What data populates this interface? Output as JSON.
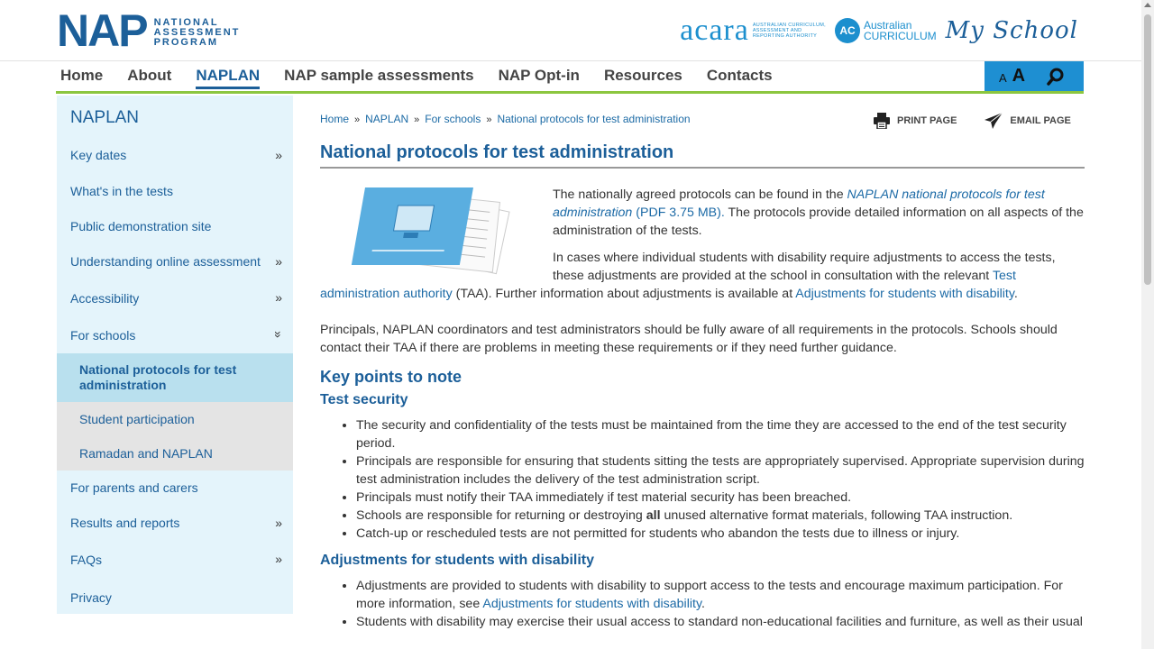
{
  "header": {
    "nap_logo_big": "NAP",
    "nap_logo_lines": [
      "NATIONAL",
      "ASSESSMENT",
      "PROGRAM"
    ],
    "acara_word": "acara",
    "acara_sub": [
      "AUSTRALIAN CURRICULUM,",
      "ASSESSMENT AND",
      "REPORTING AUTHORITY"
    ],
    "ac_badge": "AC",
    "ac_text": [
      "Australian",
      "CURRICULUM"
    ],
    "myschool": "My School"
  },
  "nav": {
    "items": [
      {
        "label": "Home",
        "active": false
      },
      {
        "label": "About",
        "active": false
      },
      {
        "label": "NAPLAN",
        "active": true
      },
      {
        "label": "NAP sample assessments",
        "active": false
      },
      {
        "label": "NAP Opt-in",
        "active": false
      },
      {
        "label": "Resources",
        "active": false
      },
      {
        "label": "Contacts",
        "active": false
      }
    ],
    "font_small": "A",
    "font_large": "A"
  },
  "sidebar": {
    "title": "NAPLAN",
    "items": [
      {
        "label": "Key dates",
        "chevron": "»"
      },
      {
        "label": "What's in the tests",
        "chevron": ""
      },
      {
        "label": "Public demonstration site",
        "chevron": ""
      },
      {
        "label": "Understanding online assessment",
        "chevron": "»"
      },
      {
        "label": "Accessibility",
        "chevron": "»"
      },
      {
        "label": "For schools",
        "chevron": "»"
      }
    ],
    "sub_items": [
      {
        "label": "National protocols for test administration",
        "active": true
      },
      {
        "label": "Student participation",
        "active": false
      },
      {
        "label": "Ramadan and NAPLAN",
        "active": false
      }
    ],
    "items_after": [
      {
        "label": "For parents and carers",
        "chevron": ""
      },
      {
        "label": "Results and reports",
        "chevron": "»"
      },
      {
        "label": "FAQs",
        "chevron": "»"
      },
      {
        "label": "Privacy",
        "chevron": ""
      }
    ]
  },
  "breadcrumb": [
    "Home",
    "NAPLAN",
    "For schools",
    "National protocols for test administration"
  ],
  "actions": {
    "print": "PRINT PAGE",
    "email": "EMAIL PAGE"
  },
  "page_title": "National protocols for test administration",
  "intro": {
    "p1_before": "The nationally agreed protocols can be found in the ",
    "p1_link": "NAPLAN national protocols for test administration",
    "p1_link_meta": " (PDF 3.75 MB).",
    "p1_after": " The protocols provide detailed information on all aspects of the administration of the tests.",
    "p2_before": "In cases where individual students with disability require adjustments to access the tests, these adjustments are provided at the school in consultation with the relevant ",
    "p2_link1": "Test administration authority",
    "p2_mid": " (TAA). Further information about adjustments is available at ",
    "p2_link2": "Adjustments for students with disability",
    "p2_end": ".",
    "p3": "Principals, NAPLAN coordinators and test administrators should be fully aware of all requirements in the protocols. Schools should contact their TAA if there are problems in meeting these requirements or if they need further guidance."
  },
  "key_points_heading": "Key points to note",
  "security": {
    "heading": "Test security",
    "bullets": [
      "The security and confidentiality of the tests must be maintained from the time they are accessed to the end of the test security period.",
      "Principals are responsible for ensuring that students sitting the tests are appropriately supervised. Appropriate supervision during test administration includes the delivery of the test administration script.",
      "Principals must notify their TAA immediately if test material security has been breached."
    ],
    "bullet4_before": "Schools are responsible for returning or destroying ",
    "bullet4_bold": "all",
    "bullet4_after": " unused alternative format materials, following TAA instruction.",
    "bullet5": "Catch-up or rescheduled tests are not permitted for students who abandon the tests due to illness or injury."
  },
  "adjustments": {
    "heading": "Adjustments for students with disability",
    "b1_before": "Adjustments are provided to students with disability to support access to the tests and encourage maximum participation. For more information, see ",
    "b1_link": "Adjustments for students with disability",
    "b1_end": ".",
    "b2": "Students with disability may exercise their usual access to standard non-educational facilities and furniture, as well as their usual"
  }
}
